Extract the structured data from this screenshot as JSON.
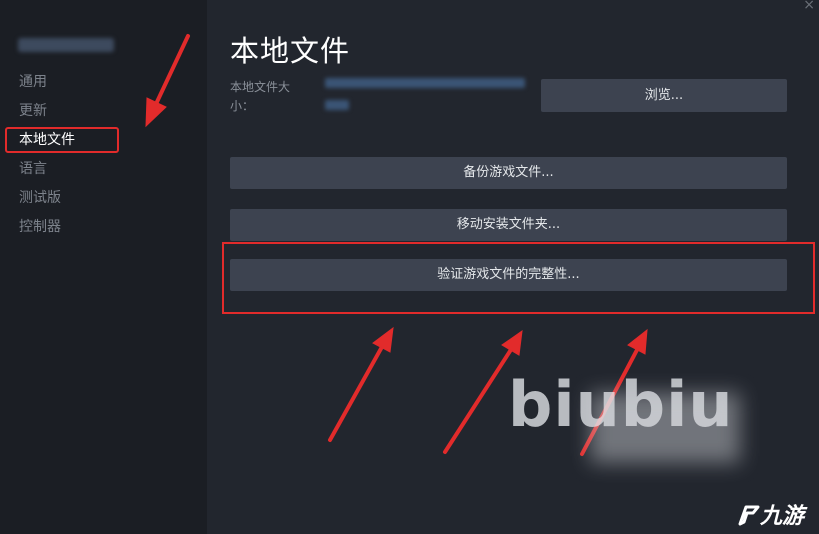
{
  "sidebar": {
    "items": [
      {
        "label": "通用",
        "active": false
      },
      {
        "label": "更新",
        "active": false
      },
      {
        "label": "本地文件",
        "active": true
      },
      {
        "label": "语言",
        "active": false
      },
      {
        "label": "测试版",
        "active": false
      },
      {
        "label": "控制器",
        "active": false
      }
    ]
  },
  "main": {
    "title": "本地文件",
    "size_label": "本地文件大小：",
    "browse_label": "浏览...",
    "backup_label": "备份游戏文件...",
    "move_label": "移动安装文件夹...",
    "verify_label": "验证游戏文件的完整性..."
  },
  "close_glyph": "×",
  "watermark": {
    "text": "biubiu"
  },
  "logo": {
    "text": "九游"
  },
  "colors": {
    "annotation_red": "#e22b2b",
    "button_bg": "#3d4350",
    "sidebar_bg": "#1b1e24",
    "main_bg": "#22262e"
  }
}
